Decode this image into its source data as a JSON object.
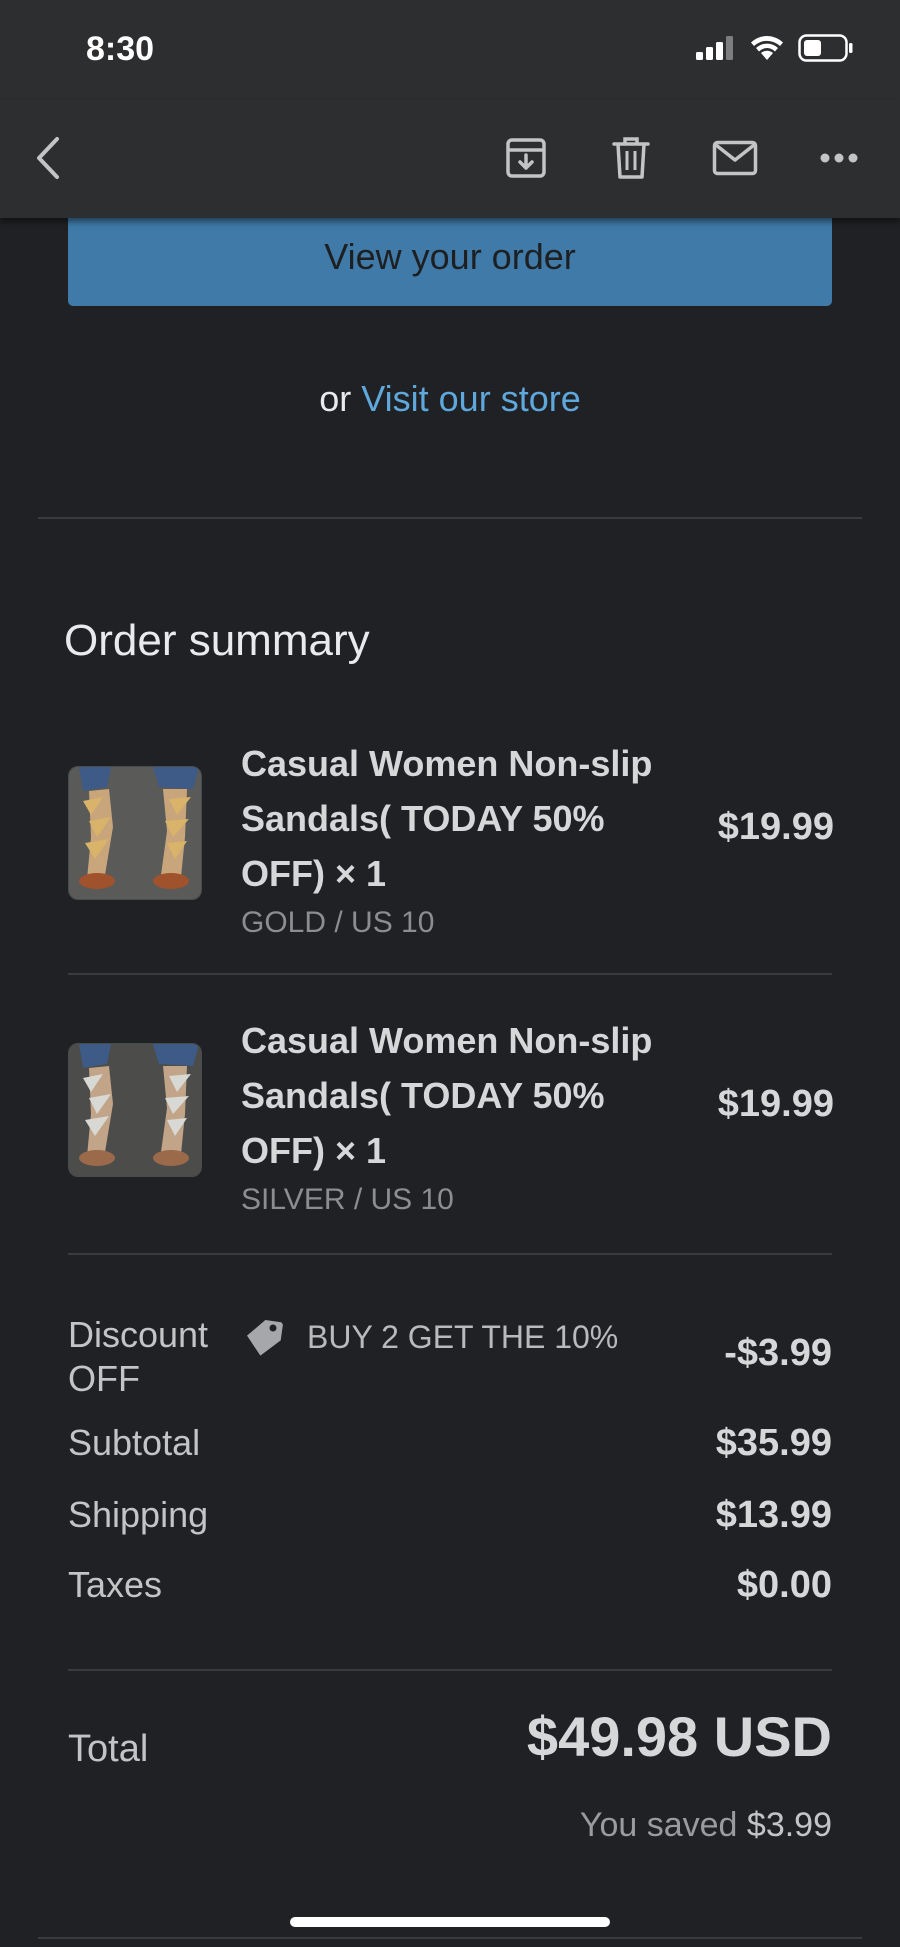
{
  "status_bar": {
    "time": "8:30"
  },
  "toolbar": {
    "back_icon": "chevron-left-icon",
    "archive_icon": "archive-icon",
    "delete_icon": "trash-icon",
    "mail_icon": "mail-icon",
    "more_icon": "more-horizontal-icon"
  },
  "order_actions": {
    "view_order_label": "View your order",
    "or_text": "or",
    "store_link": "Visit our store"
  },
  "order_summary": {
    "title": "Order summary",
    "items": [
      {
        "name": "Casual Women Non-slip Sandals( TODAY 50% OFF) × 1",
        "variant": "GOLD / US 10",
        "price": "$19.99"
      },
      {
        "name": "Casual Women Non-slip Sandals( TODAY 50% OFF) × 1",
        "variant": "SILVER / US 10",
        "price": "$19.99"
      }
    ],
    "discount": {
      "label_line1": "Discount",
      "label_line2": "OFF",
      "code": "BUY 2 GET THE 10%",
      "value": "-$3.99"
    },
    "subtotal": {
      "label": "Subtotal",
      "value": "$35.99"
    },
    "shipping": {
      "label": "Shipping",
      "value": "$13.99"
    },
    "taxes": {
      "label": "Taxes",
      "value": "$0.00"
    },
    "total": {
      "label": "Total",
      "value": "$49.98 USD"
    },
    "saved": {
      "label": "You saved",
      "value": "$3.99"
    }
  },
  "colors": {
    "background": "#202124",
    "bar": "#2d2e30",
    "button": "#3f7aa8",
    "link": "#5ea8dc"
  }
}
